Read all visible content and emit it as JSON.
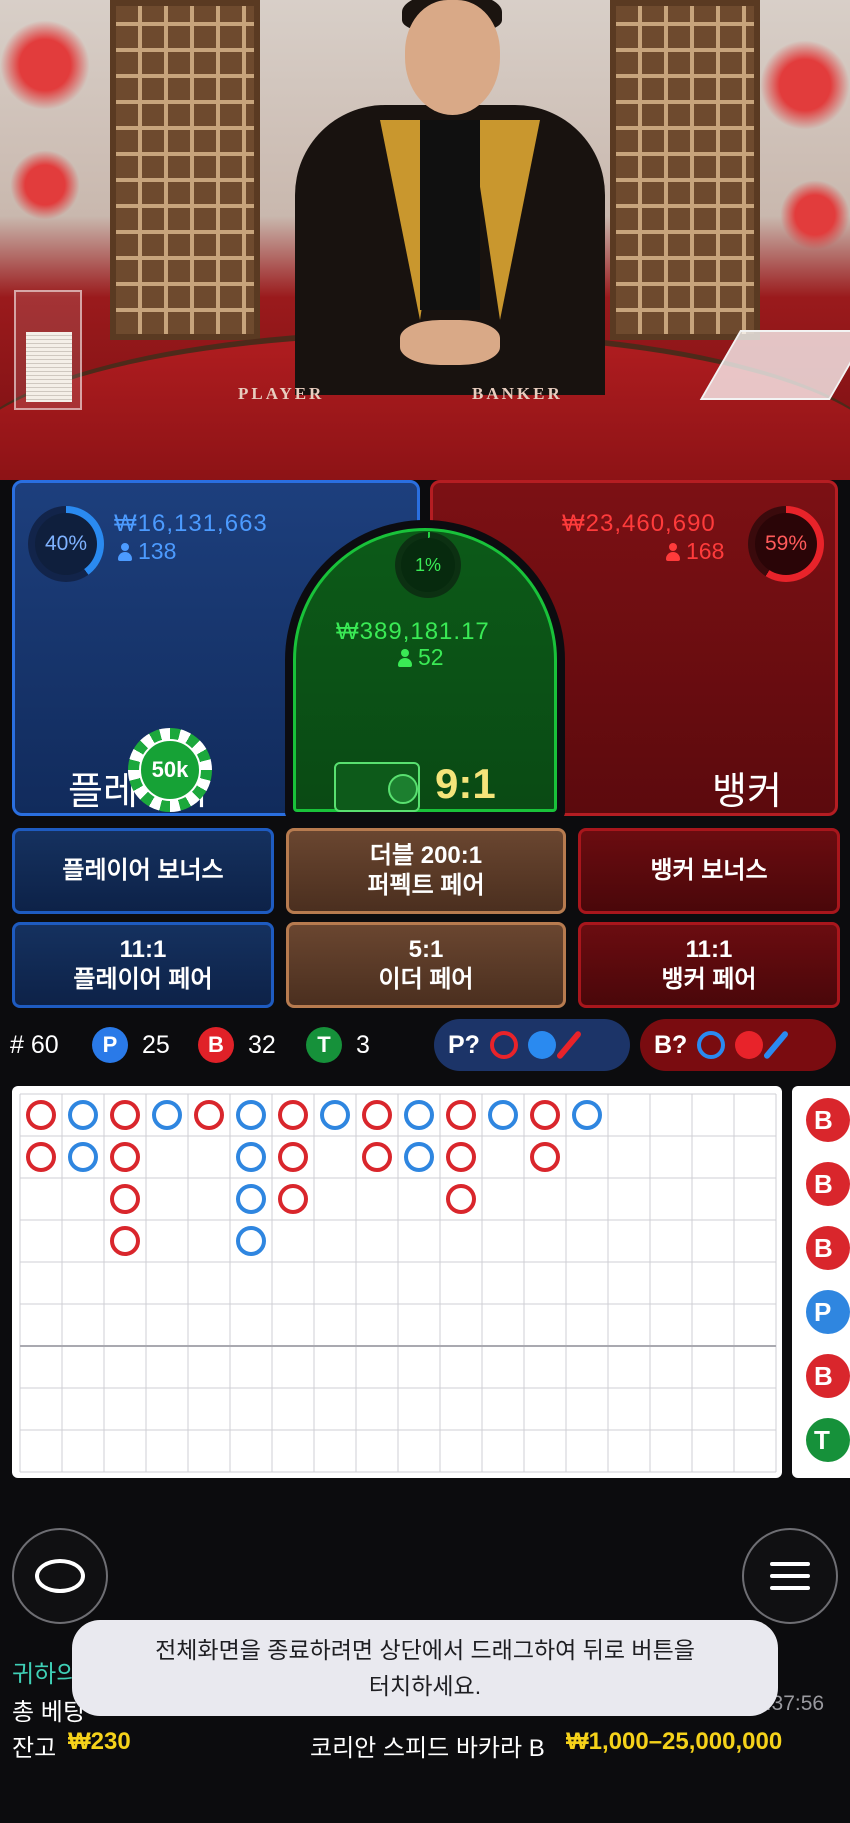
{
  "video": {
    "table_labels": {
      "player": "PLAYER",
      "banker": "BANKER"
    }
  },
  "player": {
    "percent": "40%",
    "amount": "₩16,131,663",
    "bettors": "138",
    "label": "플레이어",
    "chip": "50k",
    "color": "#2a6fe0"
  },
  "banker": {
    "percent": "59%",
    "amount": "₩23,460,690",
    "bettors": "168",
    "label": "뱅커",
    "color": "#e8232a"
  },
  "tie": {
    "percent": "1%",
    "amount": "₩389,181.17",
    "bettors": "52",
    "payout": "9:1",
    "color": "#19c23a"
  },
  "side_bets": {
    "player_bonus": "플레이어 보너스",
    "perfect_pair_line1": "더블 200:1",
    "perfect_pair_line2": "퍼펙트 페어",
    "banker_bonus": "뱅커 보너스",
    "player_pair_odds": "11:1",
    "player_pair": "플레이어 페어",
    "either_pair_odds": "5:1",
    "either_pair": "이더 페어",
    "banker_pair_odds": "11:1",
    "banker_pair": "뱅커 페어"
  },
  "stats": {
    "round": "# 60",
    "p_label": "P",
    "p_count": "25",
    "b_label": "B",
    "b_count": "32",
    "t_label": "T",
    "t_count": "3",
    "p_predict": "P?",
    "b_predict": "B?"
  },
  "big_road": [
    [
      "B",
      "B"
    ],
    [
      "P",
      "P"
    ],
    [
      "B",
      "B",
      "B",
      "B"
    ],
    [
      "P"
    ],
    [
      "B"
    ],
    [
      "P",
      "P",
      "P",
      "P"
    ],
    [
      "B",
      "B",
      "B"
    ],
    [
      "P"
    ],
    [
      "B",
      "B"
    ],
    [
      "P",
      "P"
    ],
    [
      "B",
      "B",
      "B"
    ],
    [
      "P"
    ],
    [
      "B",
      "B"
    ],
    [
      "P"
    ]
  ],
  "side_road": [
    "B",
    "B",
    "B",
    "P",
    "B",
    "T"
  ],
  "toast": {
    "line1": "전체화면을 종료하려면 상단에서 드래그하여 뒤로 버튼을",
    "line2": "터치하세요."
  },
  "footer": {
    "welcome_partial": "귀하의",
    "total_bet_label": "총 베팅",
    "time_partial": "9:37:56",
    "balance_label": "잔고",
    "balance_value": "₩230",
    "table_name": "코리안 스피드 바카라 B",
    "limits": "₩1,000–25,000,000"
  }
}
